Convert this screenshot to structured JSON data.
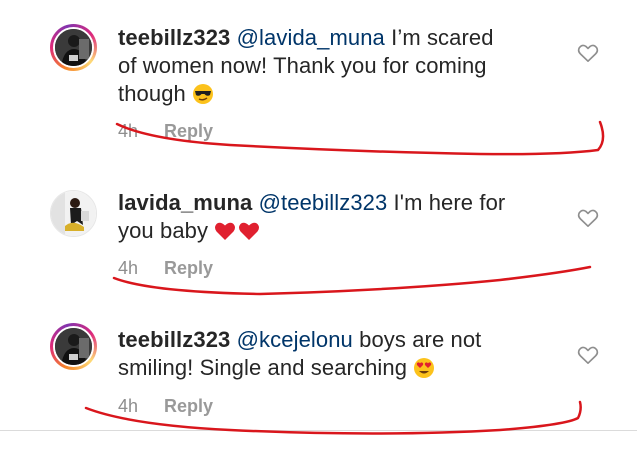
{
  "comments": [
    {
      "username": "teebillz323",
      "mention": "@lavida_muna",
      "text_line1": " I’m scared",
      "text_line2": "of women now! Thank you for coming",
      "text_line3": "though",
      "emoji": "sunglasses-face",
      "time": "4h",
      "reply_label": "Reply"
    },
    {
      "username": "lavida_muna",
      "mention": "@teebillz323",
      "text_line1": " I'm here for",
      "text_line2": "you baby",
      "emoji": "two-red-hearts",
      "time": "4h",
      "reply_label": "Reply"
    },
    {
      "username": "teebillz323",
      "mention": "@kcejelonu",
      "text_line1": " boys are not",
      "text_line2": "smiling! Single and searching",
      "emoji": "heart-eyes-face",
      "time": "4h",
      "reply_label": "Reply"
    }
  ],
  "colors": {
    "mention": "#003569",
    "meta": "#8e8e8e",
    "annotation": "#d9161c"
  }
}
